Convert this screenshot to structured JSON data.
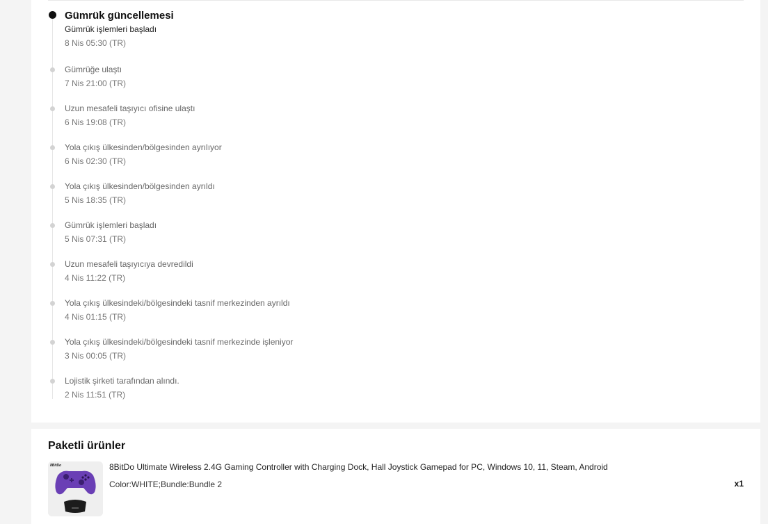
{
  "tracking": {
    "current": {
      "title": "Gümrük güncellemesi",
      "status": "Gümrük işlemleri başladı",
      "time": "8 Nis 05:30 (TR)"
    },
    "events": [
      {
        "status": "Gümrüğe ulaştı",
        "time": "7 Nis 21:00 (TR)"
      },
      {
        "status": "Uzun mesafeli taşıyıcı ofisine ulaştı",
        "time": "6 Nis 19:08 (TR)"
      },
      {
        "status": "Yola çıkış ülkesinden/bölgesinden ayrılıyor",
        "time": "6 Nis 02:30 (TR)"
      },
      {
        "status": "Yola çıkış ülkesinden/bölgesinden ayrıldı",
        "time": "5 Nis 18:35 (TR)"
      },
      {
        "status": "Gümrük işlemleri başladı",
        "time": "5 Nis 07:31 (TR)"
      },
      {
        "status": "Uzun mesafeli taşıyıcıya devredildi",
        "time": "4 Nis 11:22 (TR)"
      },
      {
        "status": "Yola çıkış ülkesindeki/bölgesindeki tasnif merkezinden ayrıldı",
        "time": "4 Nis 01:15 (TR)"
      },
      {
        "status": "Yola çıkış ülkesindeki/bölgesindeki tasnif merkezinde işleniyor",
        "time": "3 Nis 00:05 (TR)"
      },
      {
        "status": "Lojistik şirketi tarafından alındı.",
        "time": "2 Nis 11:51 (TR)"
      }
    ]
  },
  "products": {
    "title": "Paketli ürünler",
    "items": [
      {
        "name": "8BitDo Ultimate Wireless 2.4G Gaming Controller with Charging Dock, Hall Joystick Gamepad for PC, Windows 10, 11, Steam, Android",
        "variant": "Color:WHITE;Bundle:Bundle 2",
        "quantity": "x1",
        "thumb_brand": "8BitDo",
        "thumb_icon": "gamepad-controller-image",
        "colors": {
          "controller": "#6a3fb5",
          "dock": "#1c1c1c"
        }
      }
    ]
  }
}
